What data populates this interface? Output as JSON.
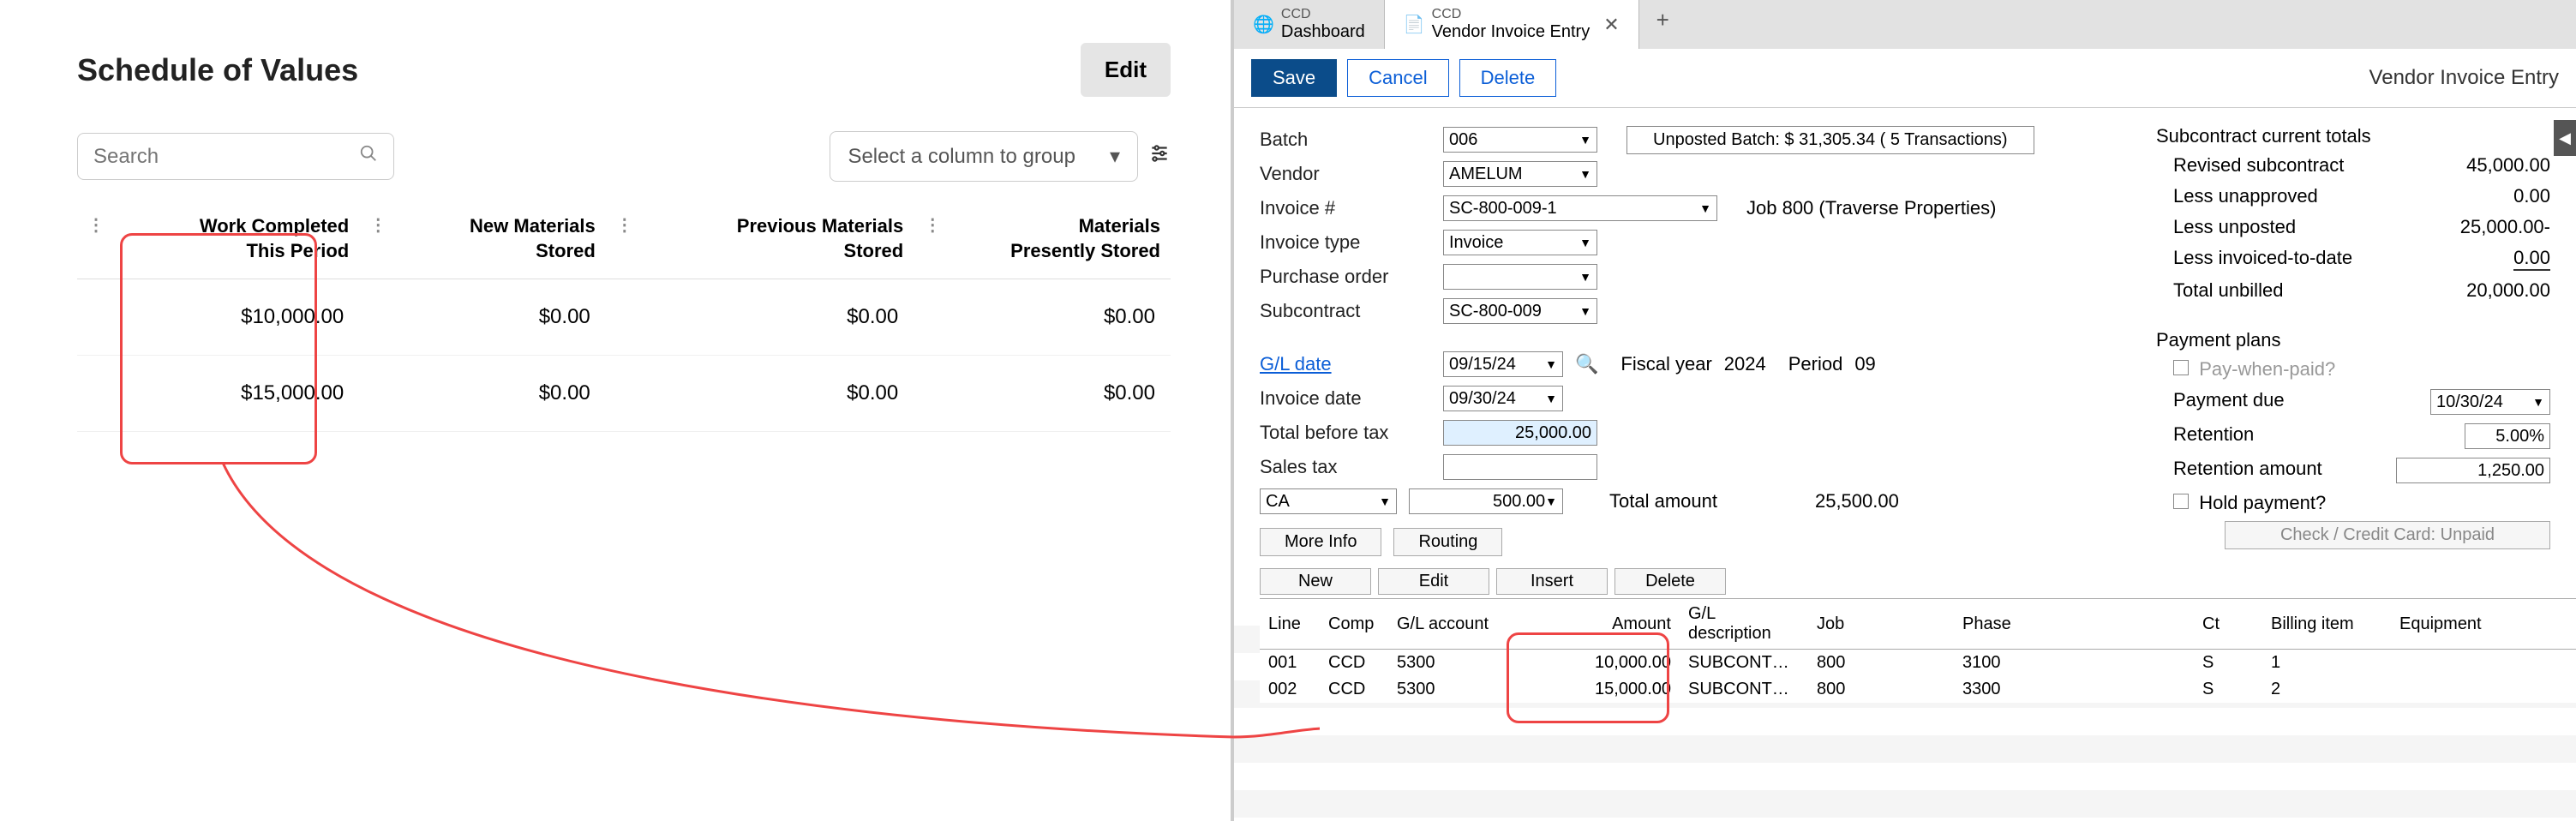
{
  "left": {
    "title": "Schedule of Values",
    "edit": "Edit",
    "search_placeholder": "Search",
    "group_placeholder": "Select a column to group",
    "columns": {
      "c1a": "Work Completed",
      "c1b": "This Period",
      "c2a": "New Materials",
      "c2b": "Stored",
      "c3a": "Previous Materials",
      "c3b": "Stored",
      "c4a": "Materials",
      "c4b": "Presently Stored"
    },
    "rows": [
      {
        "c1": "$10,000.00",
        "c2": "$0.00",
        "c3": "$0.00",
        "c4": "$0.00"
      },
      {
        "c1": "$15,000.00",
        "c2": "$0.00",
        "c3": "$0.00",
        "c4": "$0.00"
      }
    ]
  },
  "tabs": {
    "t1_small": "CCD",
    "t1_main": "Dashboard",
    "t2_small": "CCD",
    "t2_main": "Vendor Invoice Entry"
  },
  "toolbar": {
    "save": "Save",
    "cancel": "Cancel",
    "delete": "Delete",
    "title": "Vendor Invoice Entry"
  },
  "form": {
    "batch_label": "Batch",
    "batch_val": "006",
    "batch_info": "Unposted Batch: $ 31,305.34 ( 5 Transactions)",
    "vendor_label": "Vendor",
    "vendor_val": "AMELUM",
    "invoice_num_label": "Invoice #",
    "invoice_num_val": "SC-800-009-1",
    "invoice_job": "Job 800 (Traverse Properties)",
    "invoice_type_label": "Invoice type",
    "invoice_type_val": "Invoice",
    "po_label": "Purchase order",
    "po_val": "",
    "subcontract_label": "Subcontract",
    "subcontract_val": "SC-800-009",
    "gl_date_label": "G/L date",
    "gl_date_val": "09/15/24",
    "fiscal_label": "Fiscal year",
    "fiscal_val": "2024",
    "period_label": "Period",
    "period_val": "09",
    "inv_date_label": "Invoice date",
    "inv_date_val": "09/30/24",
    "total_before_label": "Total before tax",
    "total_before_val": "25,000.00",
    "sales_tax_label": "Sales tax",
    "sales_tax_val": "",
    "ca_val": "CA",
    "ca_amt": "500.00",
    "total_amount_label": "Total amount",
    "total_amount_val": "25,500.00",
    "more_info": "More Info",
    "routing": "Routing"
  },
  "side": {
    "totals_header": "Subcontract current totals",
    "revised_label": "Revised subcontract",
    "revised_val": "45,000.00",
    "less_unapproved_label": "Less unapproved",
    "less_unapproved_val": "0.00",
    "less_unposted_label": "Less unposted",
    "less_unposted_val": "25,000.00-",
    "less_invoiced_label": "Less invoiced-to-date",
    "less_invoiced_val": "0.00",
    "total_unbilled_label": "Total unbilled",
    "total_unbilled_val": "20,000.00",
    "plans_header": "Payment plans",
    "pwp_label": "Pay-when-paid?",
    "payment_due_label": "Payment due",
    "payment_due_val": "10/30/24",
    "retention_label": "Retention",
    "retention_val": "5.00%",
    "retention_amt_label": "Retention amount",
    "retention_amt_val": "1,250.00",
    "hold_label": "Hold payment?",
    "cc_label": "Check / Credit Card: Unpaid"
  },
  "gridbtns": {
    "new": "New",
    "edit": "Edit",
    "insert": "Insert",
    "delete": "Delete"
  },
  "gridhead": {
    "line": "Line",
    "comp": "Comp",
    "gl": "G/L account",
    "amount": "Amount",
    "desc": "G/L description",
    "job": "Job",
    "phase": "Phase",
    "ct": "Ct",
    "bill": "Billing item",
    "equip": "Equipment"
  },
  "gridrows": [
    {
      "line": "001",
      "comp": "CCD",
      "gl": "5300",
      "amount": "10,000.00",
      "desc": "SUBCONT…",
      "job": "800",
      "phase": "3100",
      "ct": "S",
      "bill": "1",
      "equip": ""
    },
    {
      "line": "002",
      "comp": "CCD",
      "gl": "5300",
      "amount": "15,000.00",
      "desc": "SUBCONT…",
      "job": "800",
      "phase": "3300",
      "ct": "S",
      "bill": "2",
      "equip": ""
    }
  ]
}
